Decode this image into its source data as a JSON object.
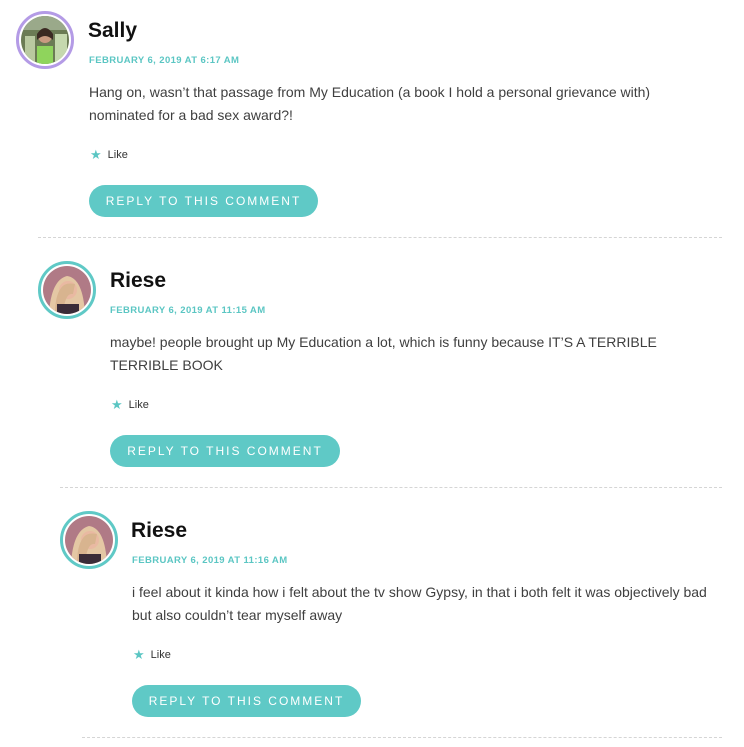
{
  "colors": {
    "accent": "#5fc9c6",
    "accent_text": "#5bc6c3",
    "sally_ring": "#b49be6",
    "riese_ring": "#5fc9c6"
  },
  "comments": [
    {
      "author": "Sally",
      "date": "FEBRUARY 6, 2019 AT 6:17 AM",
      "text": "Hang on, wasn’t that passage from My Education (a book I hold a personal grievance with) nominated for a bad sex award?!",
      "like_label": "Like",
      "reply_label": "REPLY TO THIS COMMENT",
      "avatar_icon": "user-avatar-photo"
    },
    {
      "author": "Riese",
      "date": "FEBRUARY 6, 2019 AT 11:15 AM",
      "text": "maybe! people brought up My Education a lot, which is funny because IT’S A TERRIBLE TERRIBLE BOOK",
      "like_label": "Like",
      "reply_label": "REPLY TO THIS COMMENT",
      "avatar_icon": "user-avatar-photo"
    },
    {
      "author": "Riese",
      "date": "FEBRUARY 6, 2019 AT 11:16 AM",
      "text": "i feel about it kinda how i felt about the tv show Gypsy, in that i both felt it was objectively bad but also couldn’t tear myself away",
      "like_label": "Like",
      "reply_label": "REPLY TO THIS COMMENT",
      "avatar_icon": "user-avatar-photo"
    }
  ]
}
